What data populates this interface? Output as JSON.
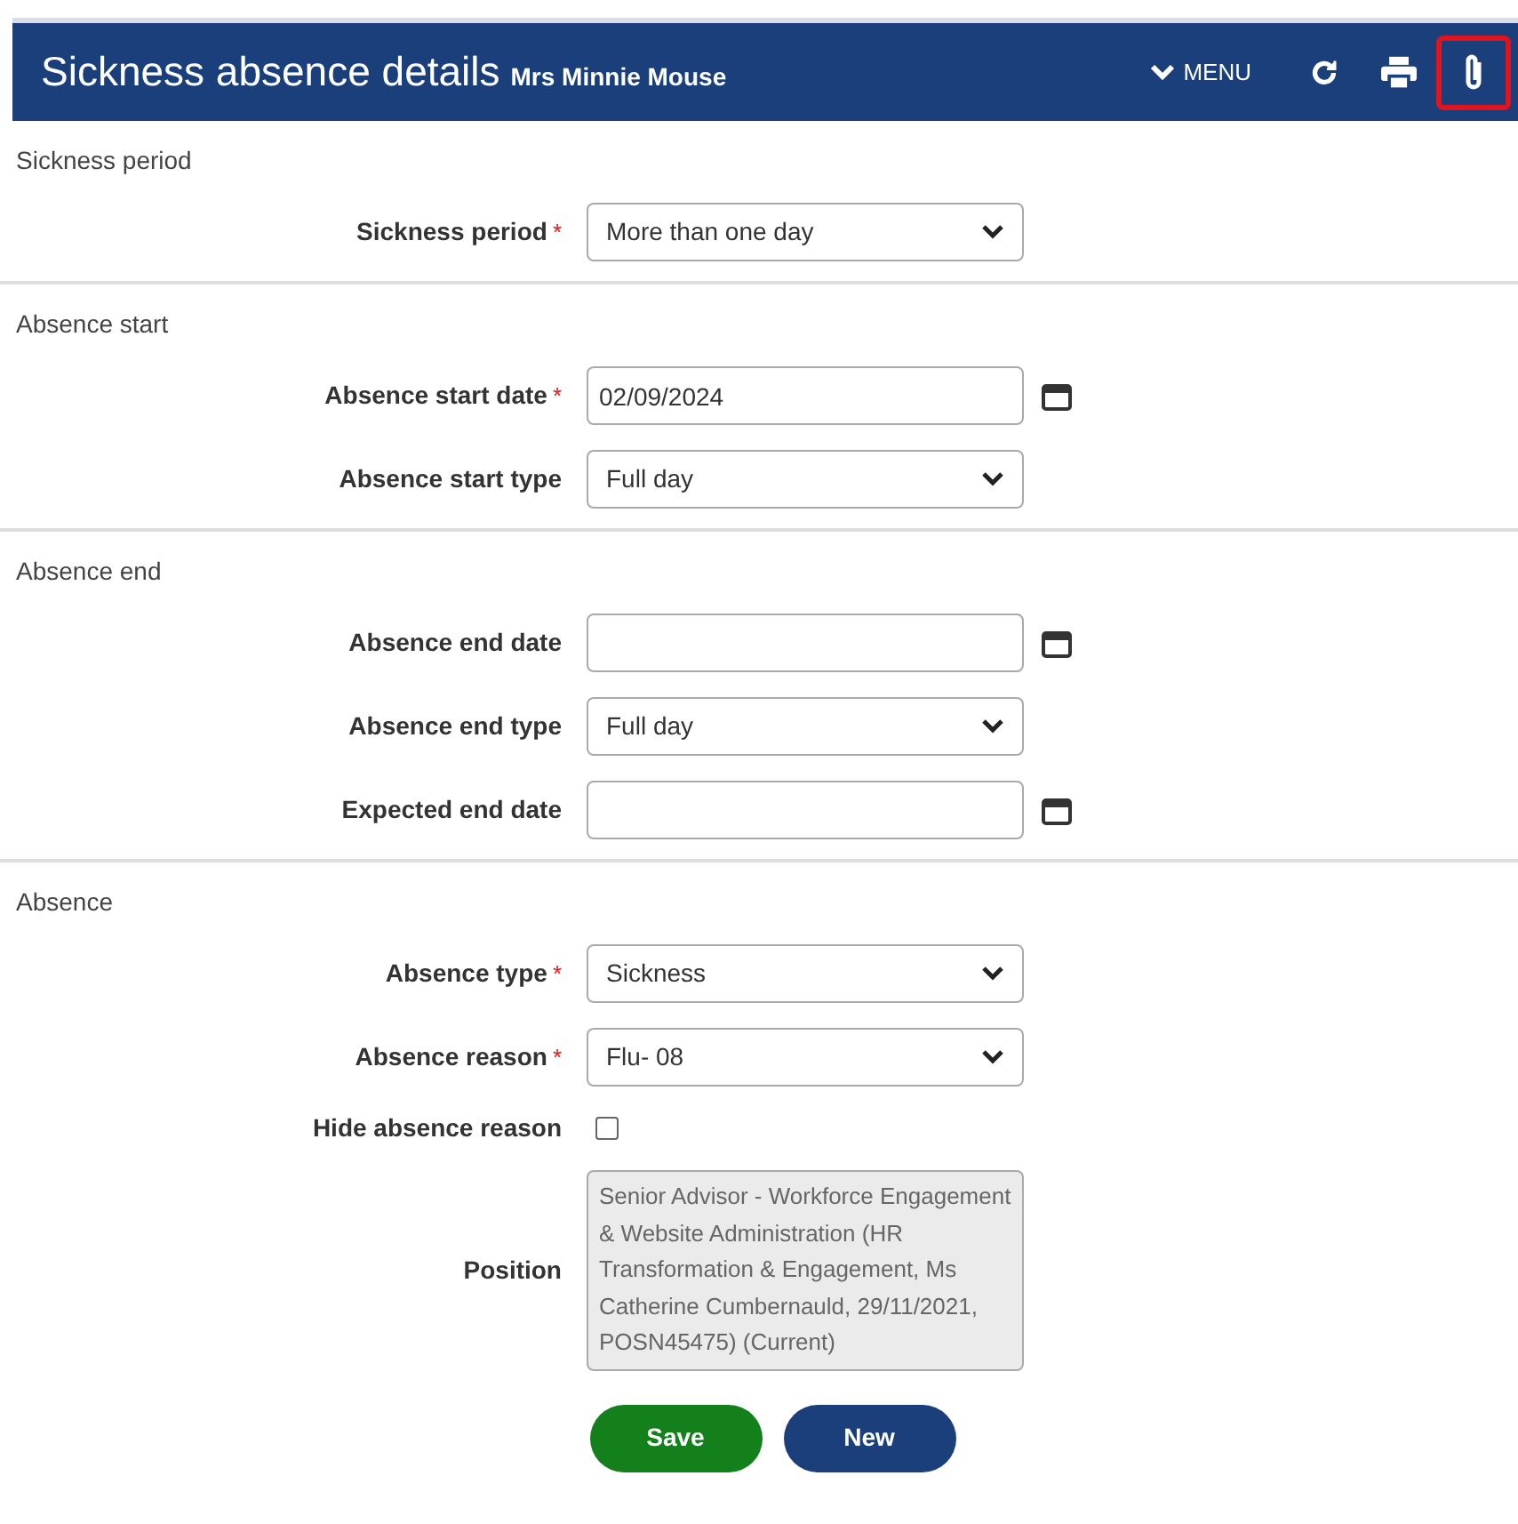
{
  "header": {
    "title": "Sickness absence details",
    "subtitle": "Mrs Minnie Mouse",
    "menu": "MENU",
    "tools": [
      {
        "kind": "refresh",
        "highlighted": false
      },
      {
        "kind": "print",
        "highlighted": false
      },
      {
        "kind": "attach",
        "highlighted": true
      }
    ]
  },
  "sections": [
    {
      "title": "Sickness period",
      "fields": [
        {
          "kind": "select",
          "label": "Sickness period",
          "marker": "*",
          "value": "More than one day"
        }
      ]
    },
    {
      "title": "Absence start",
      "fields": [
        {
          "kind": "date",
          "label": "Absence start date",
          "marker": "*",
          "value": "02/09/2024"
        },
        {
          "kind": "select",
          "label": "Absence start type",
          "value": "Full day"
        }
      ]
    },
    {
      "title": "Absence end",
      "fields": [
        {
          "kind": "date",
          "label": "Absence end date"
        },
        {
          "kind": "select",
          "label": "Absence end type",
          "value": "Full day"
        },
        {
          "kind": "date",
          "label": "Expected end date"
        }
      ]
    },
    {
      "title": "Absence",
      "fields": [
        {
          "kind": "select",
          "label": "Absence type",
          "marker": "*",
          "value": "Sickness"
        },
        {
          "kind": "select",
          "label": "Absence reason",
          "marker": "*",
          "value": "Flu- 08"
        },
        {
          "kind": "checkbox",
          "label": "Hide absence reason",
          "checked": false
        },
        {
          "kind": "textarea",
          "label": "Position",
          "value": "Senior Advisor - Workforce Engagement & Website Administration (HR Transformation & Engagement, Ms Catherine Cumbernauld, 29/11/2021, POSN45475) (Current)"
        }
      ]
    }
  ],
  "buttons": [
    {
      "label": "Save",
      "kind": "primary"
    },
    {
      "label": "New",
      "kind": "secondary"
    }
  ]
}
